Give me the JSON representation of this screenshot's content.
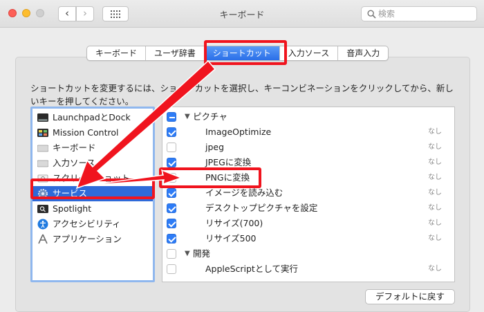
{
  "window": {
    "title": "キーボード"
  },
  "nav": {
    "back": "‹",
    "forward": "›"
  },
  "search": {
    "placeholder": "検索"
  },
  "tabs": [
    {
      "label": "キーボード",
      "active": false
    },
    {
      "label": "ユーザ辞書",
      "active": false
    },
    {
      "label": "ショートカット",
      "active": true
    },
    {
      "label": "入力ソース",
      "active": false
    },
    {
      "label": "音声入力",
      "active": false
    }
  ],
  "instructions": "ショートカットを変更するには、ショートカットを選択し、キーコンビネーションをクリックしてから、新しいキーを押してください。",
  "categories": [
    {
      "label": "LaunchpadとDock",
      "icon": "launchpad-icon",
      "selected": false
    },
    {
      "label": "Mission Control",
      "icon": "mission-control-icon",
      "selected": false
    },
    {
      "label": "キーボード",
      "icon": "keyboard-icon",
      "selected": false
    },
    {
      "label": "入力ソース",
      "icon": "input-source-icon",
      "selected": false
    },
    {
      "label": "スクリーンショット",
      "icon": "screenshot-icon",
      "selected": false
    },
    {
      "label": "サービス",
      "icon": "gear-icon",
      "selected": true
    },
    {
      "label": "Spotlight",
      "icon": "spotlight-icon",
      "selected": false
    },
    {
      "label": "アクセシビリティ",
      "icon": "accessibility-icon",
      "selected": false
    },
    {
      "label": "アプリケーション",
      "icon": "app-shortcuts-icon",
      "selected": false
    }
  ],
  "services": [
    {
      "type": "group",
      "label": "ピクチャ",
      "state": "mixed"
    },
    {
      "type": "item",
      "label": "ImageOptimize",
      "checked": true,
      "shortcut": "なし"
    },
    {
      "type": "item",
      "label": "jpeg",
      "checked": false,
      "shortcut": "なし"
    },
    {
      "type": "item",
      "label": "JPEGに変換",
      "checked": true,
      "shortcut": "なし"
    },
    {
      "type": "item",
      "label": "PNGに変換",
      "checked": false,
      "shortcut": "なし"
    },
    {
      "type": "item",
      "label": "イメージを読み込む",
      "checked": true,
      "shortcut": "なし"
    },
    {
      "type": "item",
      "label": "デスクトップピクチャを設定",
      "checked": true,
      "shortcut": "なし"
    },
    {
      "type": "item",
      "label": "リサイズ(700)",
      "checked": true,
      "shortcut": "なし"
    },
    {
      "type": "item",
      "label": "リサイズ500",
      "checked": true,
      "shortcut": "なし"
    },
    {
      "type": "group",
      "label": "開発",
      "state": "off"
    },
    {
      "type": "item",
      "label": "AppleScriptとして実行",
      "checked": false,
      "shortcut": "なし"
    }
  ],
  "buttons": {
    "restore_defaults": "デフォルトに戻す"
  },
  "annotation_color": "#f0141e",
  "selection_color": "#2e6ad9"
}
